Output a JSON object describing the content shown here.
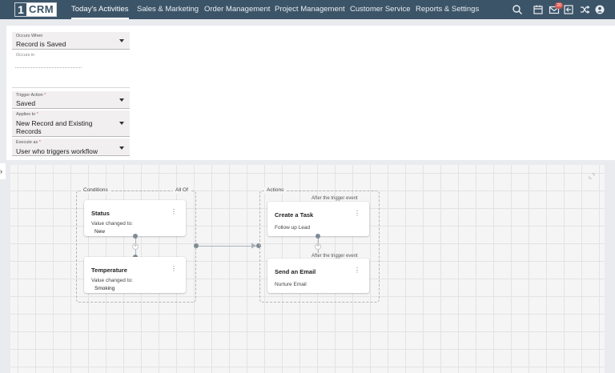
{
  "app": {
    "logo_number": "1",
    "logo_text": "CRM"
  },
  "nav": {
    "items": [
      {
        "label": "Today's Activities",
        "active": true
      },
      {
        "label": "Sales & Marketing",
        "active": false
      },
      {
        "label": "Order Management",
        "active": false
      },
      {
        "label": "Project Management",
        "active": false
      },
      {
        "label": "Customer Service",
        "active": false
      },
      {
        "label": "Reports & Settings",
        "active": false
      }
    ],
    "icons": [
      "search-icon",
      "calendar-icon",
      "mail-icon",
      "login-icon",
      "shuffle-icon",
      "user-icon"
    ],
    "mail_badge": "20"
  },
  "form": {
    "occurs_when": {
      "label": "Occurs When",
      "value": "Record is Saved"
    },
    "occurs_in": {
      "label": "Occurs in"
    },
    "trigger_action": {
      "label": "Trigger Action",
      "required": "*",
      "value": "Saved"
    },
    "applies_to": {
      "label": "Applies to",
      "required": "*",
      "value_line1": "New Record and Existing",
      "value_line2": "Records"
    },
    "execute_as": {
      "label": "Execute as",
      "required": "*",
      "value": "User who triggers workflow"
    }
  },
  "workflow": {
    "conditions": {
      "label": "Conditions",
      "mode": "All Of",
      "cards": [
        {
          "title": "Status",
          "subtitle": "Value changed to:",
          "value": "New"
        },
        {
          "title": "Temperature",
          "subtitle": "Value changed to:",
          "value": "Smoking"
        }
      ]
    },
    "actions": {
      "label": "Actions",
      "trigger_tag": "After the trigger event",
      "cards": [
        {
          "title": "Create a Task",
          "detail": "Follow up Lead"
        },
        {
          "title": "Send an Email",
          "detail": "Nurture Email"
        }
      ]
    },
    "menu_glyph": "⋮",
    "add_glyph": "+"
  },
  "colors": {
    "topbar": "#3c5468",
    "required": "#d9534f",
    "connector": "#7f8c96"
  }
}
